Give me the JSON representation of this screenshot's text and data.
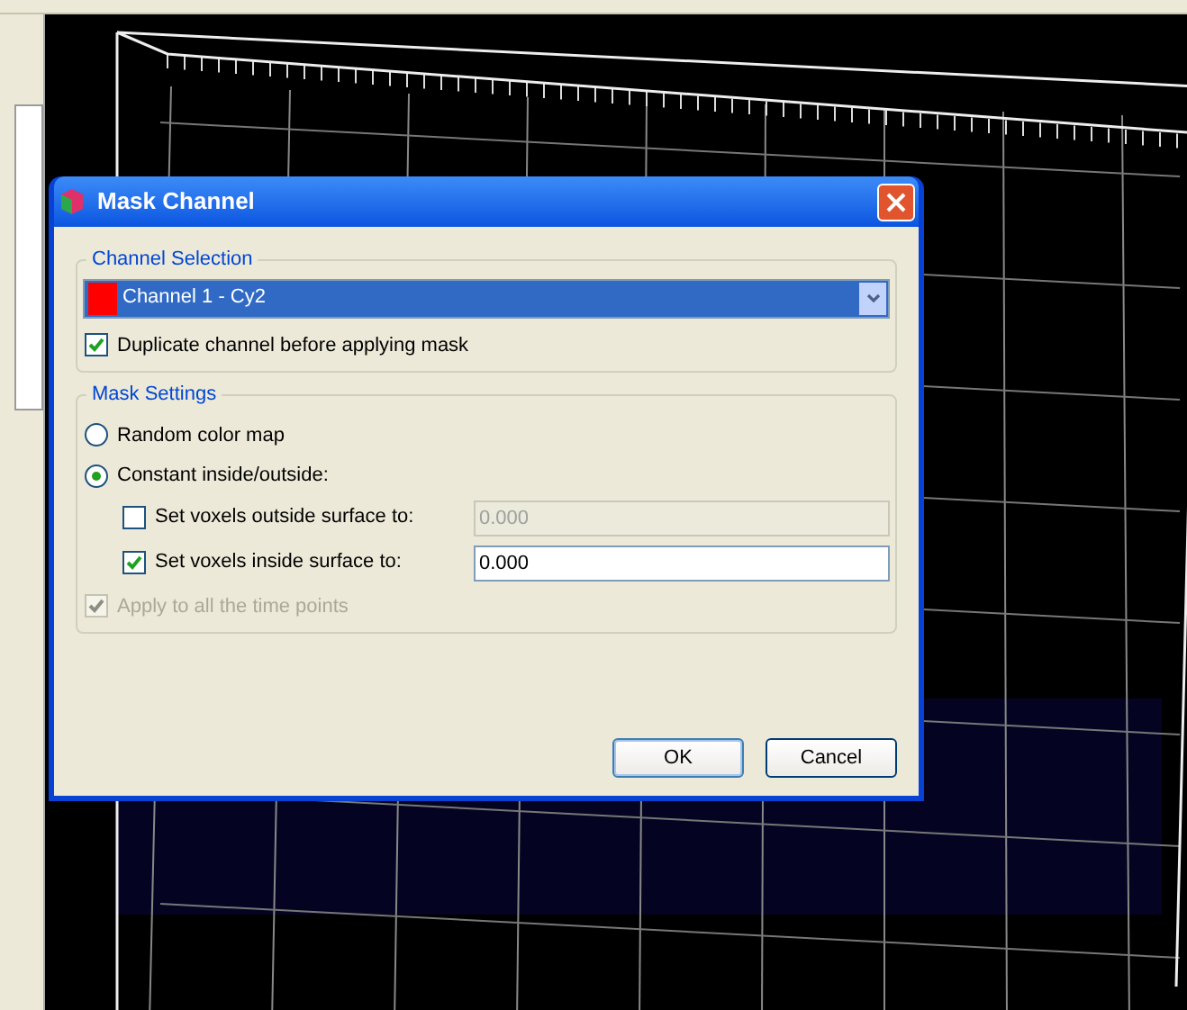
{
  "dialog": {
    "title": "Mask Channel",
    "channel_selection": {
      "legend": "Channel Selection",
      "channel": "Channel 1 - Cy2",
      "duplicate": {
        "label": "Duplicate channel before applying mask",
        "checked": true
      }
    },
    "mask_settings": {
      "legend": "Mask Settings",
      "options": [
        {
          "label": "Random color map",
          "selected": false
        },
        {
          "label": "Constant inside/outside:",
          "selected": true
        }
      ],
      "voxel_rows": [
        {
          "label": "Set voxels outside surface to:",
          "checked": false,
          "value": "0.000"
        },
        {
          "label": "Set voxels inside surface to:",
          "checked": true,
          "value": "0.000"
        }
      ],
      "apply_all": {
        "label": "Apply to all the time points",
        "checked": true,
        "disabled": true
      }
    },
    "buttons": [
      "OK",
      "Cancel"
    ]
  }
}
